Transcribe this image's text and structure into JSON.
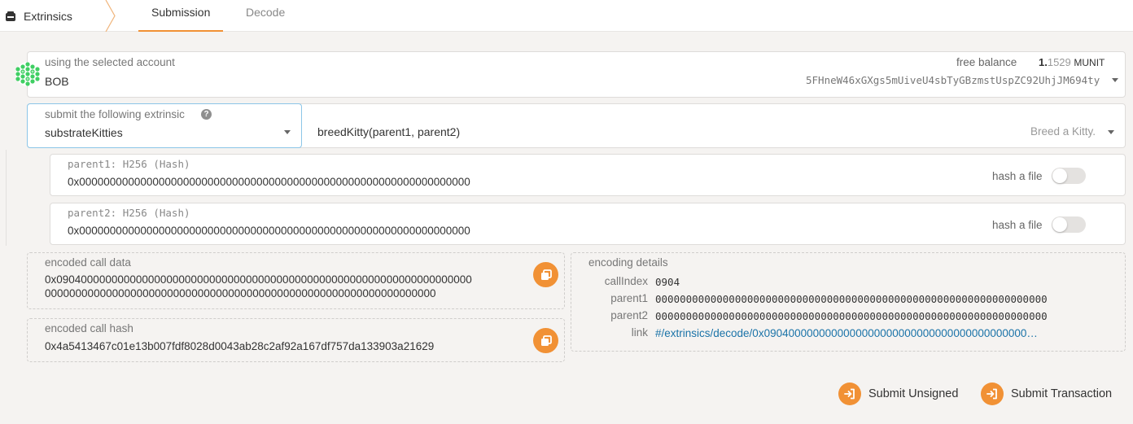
{
  "app": {
    "title": "Extrinsics",
    "tabs": [
      "Submission",
      "Decode"
    ]
  },
  "account": {
    "label": "using the selected account",
    "name": "BOB",
    "balance_label": "free balance",
    "balance_int": "1.",
    "balance_frac": "1529",
    "balance_unit": "MUNIT",
    "address": "5FHneW46xGXgs5mUiveU4sbTyGBzmstUspZC92UhjJM694ty"
  },
  "extrinsic": {
    "label": "submit the following extrinsic",
    "module": "substrateKitties",
    "method": "breedKitty(parent1, parent2)",
    "method_doc": "Breed a Kitty."
  },
  "params": [
    {
      "label": "parent1: H256 (Hash)",
      "value": "0x0000000000000000000000000000000000000000000000000000000000000000",
      "toggle_label": "hash a file"
    },
    {
      "label": "parent2: H256 (Hash)",
      "value": "0x0000000000000000000000000000000000000000000000000000000000000000",
      "toggle_label": "hash a file"
    }
  ],
  "encoded_call": {
    "label": "encoded call data",
    "line1": "0x09040000000000000000000000000000000000000000000000000000000000000000",
    "line2": "0000000000000000000000000000000000000000000000000000000000000000"
  },
  "encoded_hash": {
    "label": "encoded call hash",
    "value": "0x4a5413467c01e13b007fdf8028d0043ab28c2af92a167df757da133903a21629"
  },
  "encoding_details": {
    "title": "encoding details",
    "rows": [
      {
        "label": "callIndex",
        "value": "0904"
      },
      {
        "label": "parent1",
        "value": "0000000000000000000000000000000000000000000000000000000000000000"
      },
      {
        "label": "parent2",
        "value": "0000000000000000000000000000000000000000000000000000000000000000"
      },
      {
        "label": "link",
        "value": "#/extrinsics/decode/0x0904000000000000000000000000000000000000000…"
      }
    ]
  },
  "actions": {
    "unsigned": "Submit Unsigned",
    "transaction": "Submit Transaction"
  },
  "colors": {
    "accent": "#f19135",
    "link": "#1a73a8"
  }
}
